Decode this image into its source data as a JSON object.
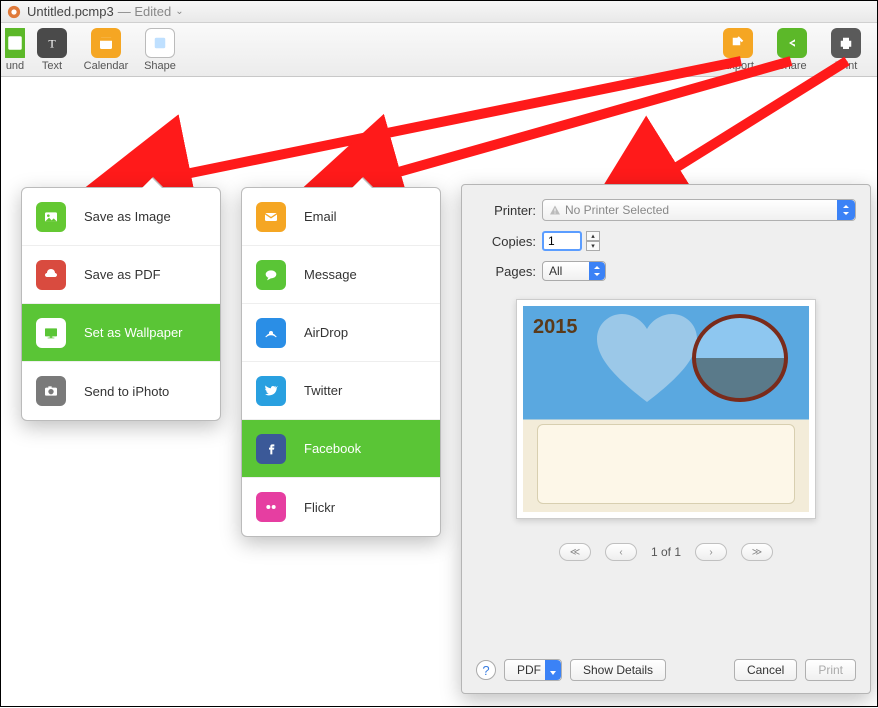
{
  "title": {
    "filename": "Untitled.pcmp3",
    "status": "— Edited"
  },
  "toolbar": {
    "left": [
      {
        "label": "und",
        "icon": "background-icon"
      },
      {
        "label": "Text",
        "icon": "text-icon"
      },
      {
        "label": "Calendar",
        "icon": "calendar-icon"
      },
      {
        "label": "Shape",
        "icon": "shape-icon"
      }
    ],
    "right": [
      {
        "label": "Export",
        "icon": "export-icon"
      },
      {
        "label": "Share",
        "icon": "share-icon"
      },
      {
        "label": "Print",
        "icon": "print-icon"
      }
    ]
  },
  "export_menu": [
    {
      "label": "Save as Image",
      "icon": "image-icon",
      "sel": false
    },
    {
      "label": "Save as PDF",
      "icon": "pdf-icon",
      "sel": false
    },
    {
      "label": "Set as Wallpaper",
      "icon": "wallpaper-icon",
      "sel": true
    },
    {
      "label": "Send to iPhoto",
      "icon": "iphoto-icon",
      "sel": false
    }
  ],
  "share_menu": [
    {
      "label": "Email",
      "icon": "email-icon",
      "sel": false
    },
    {
      "label": "Message",
      "icon": "message-icon",
      "sel": false
    },
    {
      "label": "AirDrop",
      "icon": "airdrop-icon",
      "sel": false
    },
    {
      "label": "Twitter",
      "icon": "twitter-icon",
      "sel": false
    },
    {
      "label": "Facebook",
      "icon": "facebook-icon",
      "sel": true
    },
    {
      "label": "Flickr",
      "icon": "flickr-icon",
      "sel": false
    }
  ],
  "print": {
    "printer_label": "Printer:",
    "printer_value": "No Printer Selected",
    "copies_label": "Copies:",
    "copies_value": "1",
    "pages_label": "Pages:",
    "pages_value": "All",
    "preview_year": "2015",
    "pager": "1 of 1",
    "pdf_btn": "PDF",
    "details_btn": "Show Details",
    "cancel_btn": "Cancel",
    "print_btn": "Print"
  }
}
